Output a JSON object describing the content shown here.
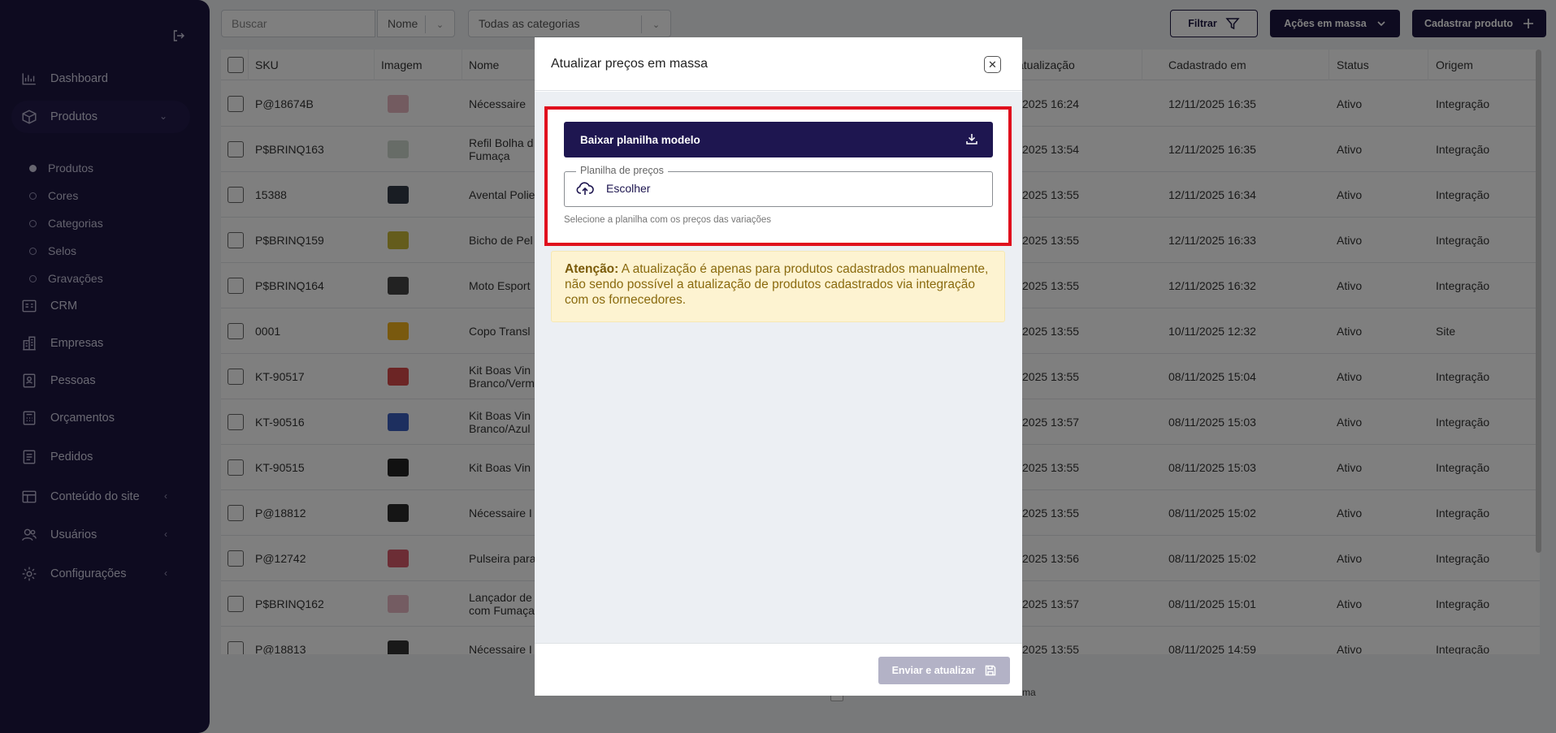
{
  "sidebar": {
    "items": [
      {
        "label": "Dashboard",
        "icon": "chart-icon"
      },
      {
        "label": "Produtos",
        "icon": "box-icon",
        "expanded": true
      },
      {
        "label": "CRM",
        "icon": "crm-icon"
      },
      {
        "label": "Empresas",
        "icon": "building-icon"
      },
      {
        "label": "Pessoas",
        "icon": "contacts-icon"
      },
      {
        "label": "Orçamentos",
        "icon": "calculator-icon"
      },
      {
        "label": "Pedidos",
        "icon": "orders-icon"
      },
      {
        "label": "Conteúdo do site",
        "icon": "window-icon"
      },
      {
        "label": "Usuários",
        "icon": "users-icon"
      },
      {
        "label": "Configurações",
        "icon": "gear-icon"
      }
    ],
    "sub_items": [
      "Produtos",
      "Cores",
      "Categorias",
      "Selos",
      "Gravações"
    ]
  },
  "toolbar": {
    "search_placeholder": "Buscar",
    "search_field": "Nome",
    "category": "Todas as categorias",
    "filter_label": "Filtrar",
    "bulk_label": "Ações em massa",
    "create_label": "Cadastrar produto"
  },
  "table": {
    "columns": [
      "SKU",
      "Imagem",
      "Nome",
      "atualização",
      "Cadastrado em",
      "Status",
      "Origem"
    ],
    "rows": [
      {
        "sku": "P@18674B",
        "name": "Nécessaire",
        "updated": "2025 16:24",
        "created": "12/11/2025 16:35",
        "status": "Ativo",
        "origin": "Integração",
        "color": "#e7b7c0"
      },
      {
        "sku": "P$BRINQ163",
        "name": "Refil Bolha d\nFumaça",
        "updated": "2025 13:54",
        "created": "12/11/2025 16:35",
        "status": "Ativo",
        "origin": "Integração",
        "color": "#cfd8cf"
      },
      {
        "sku": "15388",
        "name": "Avental Polie",
        "updated": "2025 13:55",
        "created": "12/11/2025 16:34",
        "status": "Ativo",
        "origin": "Integração",
        "color": "#333a46"
      },
      {
        "sku": "P$BRINQ159",
        "name": "Bicho de Pel",
        "updated": "2025 13:55",
        "created": "12/11/2025 16:33",
        "status": "Ativo",
        "origin": "Integração",
        "color": "#c9b938"
      },
      {
        "sku": "P$BRINQ164",
        "name": "Moto Esport",
        "updated": "2025 13:55",
        "created": "12/11/2025 16:32",
        "status": "Ativo",
        "origin": "Integração",
        "color": "#444"
      },
      {
        "sku": "0001",
        "name": "Copo Transl",
        "updated": "2025 13:55",
        "created": "10/11/2025 12:32",
        "status": "Ativo",
        "origin": "Site",
        "color": "#f2b21c"
      },
      {
        "sku": "KT-90517",
        "name": "Kit Boas Vin\nBranco/Verm",
        "updated": "2025 13:55",
        "created": "08/11/2025 15:04",
        "status": "Ativo",
        "origin": "Integração",
        "color": "#d84a4a"
      },
      {
        "sku": "KT-90516",
        "name": "Kit Boas Vin\nBranco/Azul",
        "updated": "2025 13:57",
        "created": "08/11/2025 15:03",
        "status": "Ativo",
        "origin": "Integração",
        "color": "#3a5fbf"
      },
      {
        "sku": "KT-90515",
        "name": "Kit Boas Vin",
        "updated": "2025 13:55",
        "created": "08/11/2025 15:03",
        "status": "Ativo",
        "origin": "Integração",
        "color": "#222"
      },
      {
        "sku": "P@18812",
        "name": "Nécessaire I",
        "updated": "2025 13:55",
        "created": "08/11/2025 15:02",
        "status": "Ativo",
        "origin": "Integração",
        "color": "#2a2a2a"
      },
      {
        "sku": "P@12742",
        "name": "Pulseira para",
        "updated": "2025 13:56",
        "created": "08/11/2025 15:02",
        "status": "Ativo",
        "origin": "Integração",
        "color": "#d85a6a"
      },
      {
        "sku": "P$BRINQ162",
        "name": "Lançador de\ncom Fumaça",
        "updated": "2025 13:57",
        "created": "08/11/2025 15:01",
        "status": "Ativo",
        "origin": "Integração",
        "color": "#e8b9c4"
      },
      {
        "sku": "P@18813",
        "name": "Nécessaire I",
        "updated": "2025 13:55",
        "created": "08/11/2025 14:59",
        "status": "Ativo",
        "origin": "Integração",
        "color": "#333"
      }
    ]
  },
  "footer_partial": "ma",
  "modal": {
    "title": "Atualizar preços em massa",
    "download_label": "Baixar planilha modelo",
    "file_legend": "Planilha de preços",
    "file_button": "Escolher",
    "file_helper": "Selecione a planilha com os preços das variações",
    "alert_strong": "Atenção:",
    "alert_text": " A atualização é apenas para produtos cadastrados manualmente, não sendo possível a atualização de produtos cadastrados via integração com os fornecedores.",
    "submit_label": "Enviar e atualizar"
  },
  "colors": {
    "brand": "#1c1640",
    "highlight": "#e0101d",
    "alert_bg": "#fdf3d1",
    "alert_text": "#8a6a0e"
  }
}
